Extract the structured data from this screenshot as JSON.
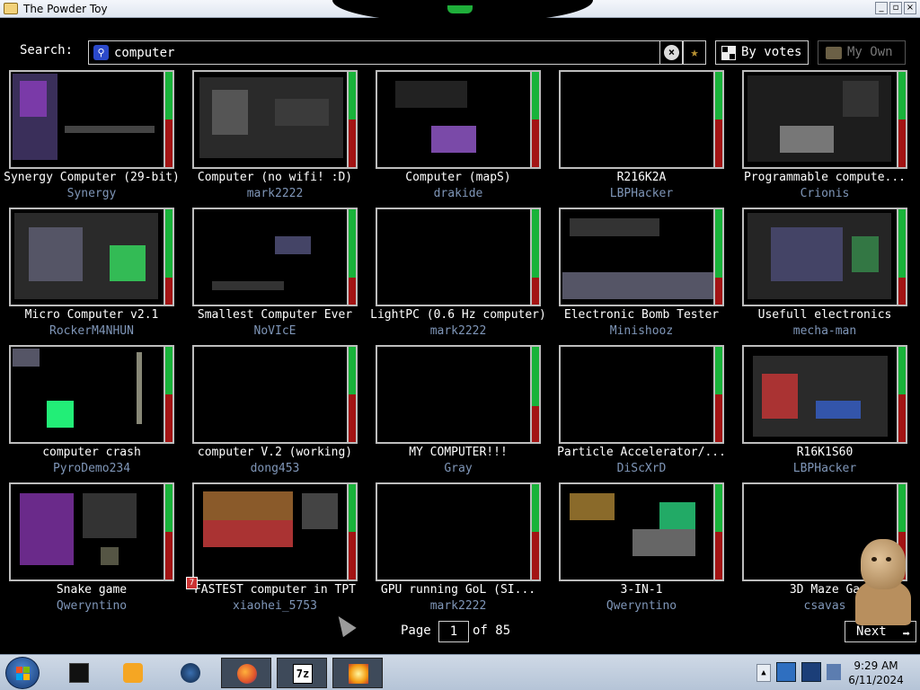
{
  "window": {
    "title": "The Powder Toy"
  },
  "search": {
    "label": "Search:",
    "query": "computer"
  },
  "toolbar": {
    "sort_label": "By votes",
    "my_own_label": "My Own"
  },
  "saves": [
    {
      "title": "Synergy Computer (29-bit)",
      "author": "Synergy",
      "up_ratio": 0.5
    },
    {
      "title": "Computer (no wifi! :D)",
      "author": "mark2222",
      "up_ratio": 0.5
    },
    {
      "title": "Computer (mapS)",
      "author": "drakide",
      "up_ratio": 0.5
    },
    {
      "title": "R216K2A",
      "author": "LBPHacker",
      "up_ratio": 0.5
    },
    {
      "title": "Programmable compute...",
      "author": "Crionis",
      "up_ratio": 0.5
    },
    {
      "title": "Micro Computer v2.1",
      "author": "RockerM4NHUN",
      "up_ratio": 0.72
    },
    {
      "title": "Smallest Computer Ever",
      "author": "NoVIcE",
      "up_ratio": 0.72
    },
    {
      "title": "LightPC (0.6 Hz computer)",
      "author": "mark2222",
      "up_ratio": 0.72
    },
    {
      "title": "Electronic Bomb Tester",
      "author": "Minishooz",
      "up_ratio": 0.72
    },
    {
      "title": "Usefull electronics",
      "author": "mecha-man",
      "up_ratio": 0.72
    },
    {
      "title": "computer crash",
      "author": "PyroDemo234",
      "up_ratio": 0.5
    },
    {
      "title": "computer V.2 (working)",
      "author": "dong453",
      "up_ratio": 0.5
    },
    {
      "title": "MY COMPUTER!!!",
      "author": "Gray",
      "up_ratio": 0.62
    },
    {
      "title": "Particle Accelerator/...",
      "author": "DiScXrD",
      "up_ratio": 0.5
    },
    {
      "title": "R16K1S60",
      "author": "LBPHacker",
      "up_ratio": 0.5
    },
    {
      "title": "Snake game",
      "author": "Qweryntino",
      "up_ratio": 0.5
    },
    {
      "title": "FASTEST computer in TPT",
      "author": "xiaohei_5753",
      "up_ratio": 0.5
    },
    {
      "title": "GPU running GoL (SI...",
      "author": "mark2222",
      "up_ratio": 0.5
    },
    {
      "title": "3-IN-1",
      "author": "Qweryntino",
      "up_ratio": 0.5
    },
    {
      "title": "3D Maze Ga",
      "author": "csavas",
      "up_ratio": 0.5
    }
  ],
  "pagination": {
    "page_label": "Page",
    "current": "1",
    "of_label": "of 85",
    "next_label": "Next"
  },
  "taskbar": {
    "time": "9:29 AM",
    "date": "6/11/2024"
  },
  "colors": {
    "vote_up": "#19b33a",
    "vote_down": "#a31414",
    "author": "#7f96b8"
  },
  "icons": [
    "app-icon",
    "search-icon",
    "clear-icon",
    "star-icon",
    "sort-icon",
    "folder-icon",
    "arrow-right-icon",
    "windows-start-icon",
    "firefox-icon",
    "7zip-icon"
  ]
}
